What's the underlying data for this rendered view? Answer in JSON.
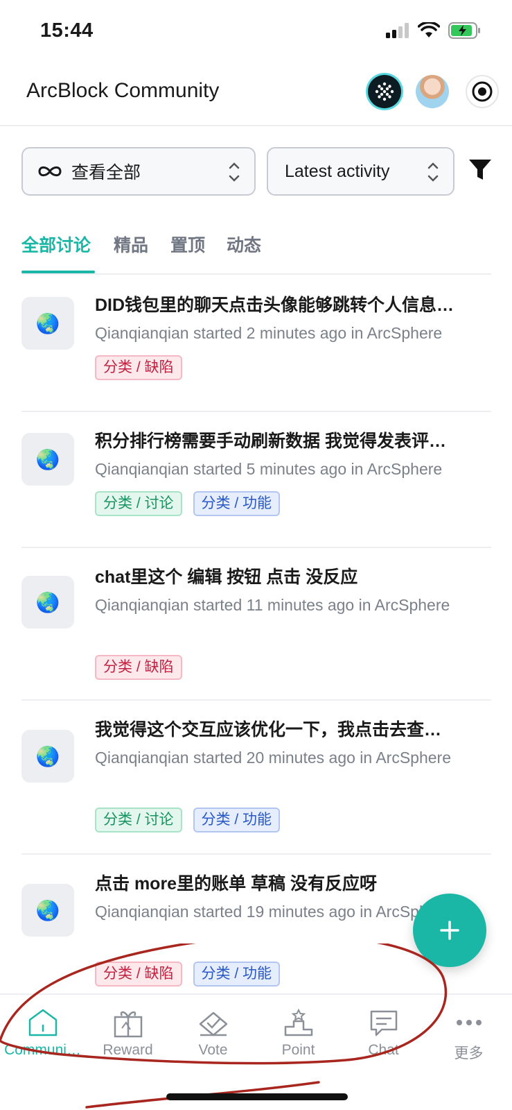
{
  "status_bar": {
    "time": "15:44"
  },
  "header": {
    "title": "ArcBlock Community"
  },
  "filters": {
    "scope_label": "查看全部",
    "sort_label": "Latest activity"
  },
  "tabs": [
    {
      "label": "全部讨论",
      "active": true
    },
    {
      "label": "精品",
      "active": false
    },
    {
      "label": "置顶",
      "active": false
    },
    {
      "label": "动态",
      "active": false
    }
  ],
  "posts": [
    {
      "avatar": "🌏",
      "title": "DID钱包里的聊天点击头像能够跳转个人信息…",
      "meta": "Qianqianqian started 2 minutes ago in ArcSphere",
      "tags": [
        {
          "label": "分类 / 缺陷",
          "kind": "bug"
        }
      ]
    },
    {
      "avatar": "🌏",
      "title": "积分排行榜需要手动刷新数据 我觉得发表评…",
      "meta": "Qianqianqian started 5 minutes ago in ArcSphere",
      "tags": [
        {
          "label": "分类 / 讨论",
          "kind": "discuss"
        },
        {
          "label": "分类 / 功能",
          "kind": "feature"
        }
      ]
    },
    {
      "avatar": "🌏",
      "title": "chat里这个 编辑 按钮 点击 没反应",
      "meta": "Qianqianqian started 11 minutes ago in ArcSphere",
      "tags": [
        {
          "label": "分类 / 缺陷",
          "kind": "bug"
        }
      ]
    },
    {
      "avatar": "🌏",
      "title": "我觉得这个交互应该优化一下，我点击去查…",
      "meta": "Qianqianqian started 20 minutes ago in ArcSphere",
      "tags": [
        {
          "label": "分类 / 讨论",
          "kind": "discuss"
        },
        {
          "label": "分类 / 功能",
          "kind": "feature"
        }
      ]
    },
    {
      "avatar": "🌏",
      "title": "点击 more里的账单 草稿 没有反应呀",
      "meta": "Qianqianqian started 19 minutes ago in ArcSphere",
      "tags": [
        {
          "label": "分类 / 缺陷",
          "kind": "bug"
        },
        {
          "label": "分类 / 功能",
          "kind": "feature"
        }
      ]
    }
  ],
  "fab": {
    "icon": "plus-icon"
  },
  "bottom_nav": [
    {
      "label": "Communi…",
      "icon": "home-icon",
      "active": true
    },
    {
      "label": "Reward",
      "icon": "gift-icon",
      "active": false
    },
    {
      "label": "Vote",
      "icon": "vote-icon",
      "active": false
    },
    {
      "label": "Point",
      "icon": "podium-icon",
      "active": false
    },
    {
      "label": "Chat",
      "icon": "chat-icon",
      "active": false
    },
    {
      "label": "更多",
      "icon": "more-icon",
      "active": false
    }
  ],
  "colors": {
    "accent": "#1ab7a7",
    "annotation": "#a8261e"
  }
}
